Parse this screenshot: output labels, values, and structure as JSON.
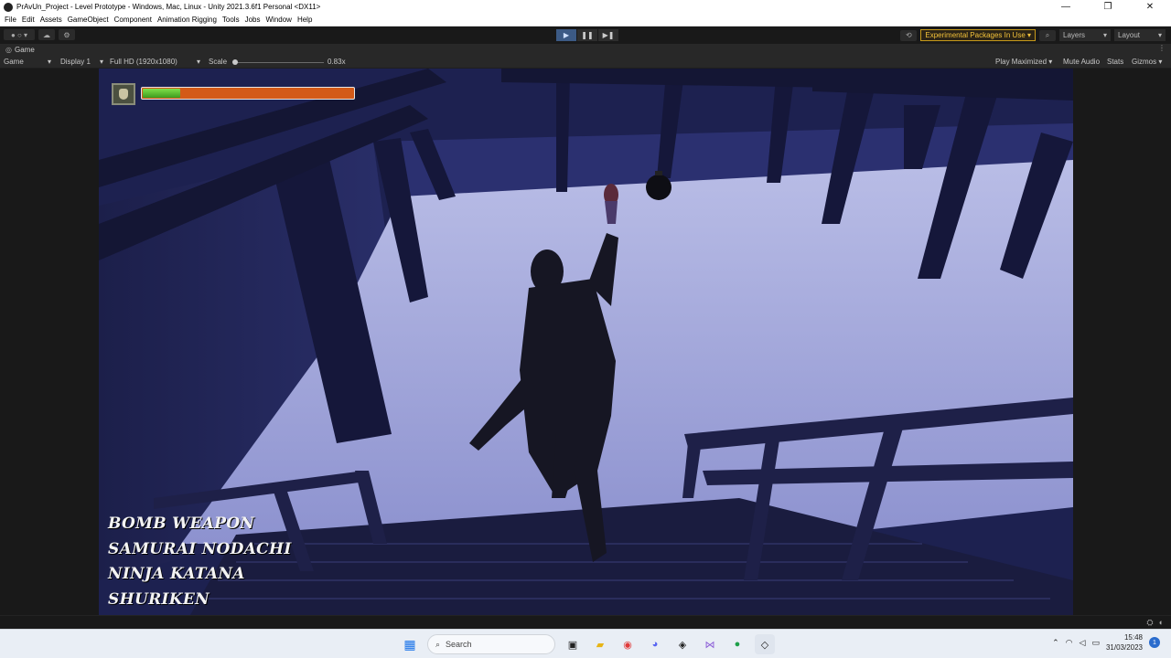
{
  "window": {
    "title": "PrAvUn_Project - Level Prototype - Windows, Mac, Linux - Unity 2021.3.6f1 Personal <DX11>",
    "controls": [
      "—",
      "❐",
      "✕"
    ]
  },
  "menu": [
    "File",
    "Edit",
    "Assets",
    "GameObject",
    "Component",
    "Animation Rigging",
    "Tools",
    "Jobs",
    "Window",
    "Help"
  ],
  "toolbar": {
    "account_icon": "account-icon",
    "cloud_icon": "cloud-icon",
    "collab_icon": "collab-icon",
    "play_icon": "play-icon",
    "pause_icon": "pause-icon",
    "step_icon": "step-icon",
    "history_icon": "history-icon",
    "experimental_label": "Experimental Packages In Use ▾",
    "search_icon": "search-icon",
    "layers_label": "Layers",
    "layout_label": "Layout"
  },
  "tab": {
    "label": "Game",
    "icon": "game-controller-icon"
  },
  "gamebar": {
    "mode": "Game",
    "display": "Display 1",
    "resolution": "Full HD (1920x1080)",
    "scale_label": "Scale",
    "scale_value": "0.83x",
    "play_maximized": "Play Maximized",
    "mute_audio": "Mute Audio",
    "stats": "Stats",
    "gizmos": "Gizmos"
  },
  "hud": {
    "health_fraction": 0.18,
    "health_color": "#4fbf2a",
    "damage_color": "#d35a18",
    "weapons": [
      "BOMB WEAPON",
      "SAMURAI NODACHI",
      "NINJA KATANA",
      "SHURIKEN"
    ]
  },
  "taskbar": {
    "search_placeholder": "Search",
    "time": "15:48",
    "date": "31/03/2023",
    "notification_count": "1"
  }
}
